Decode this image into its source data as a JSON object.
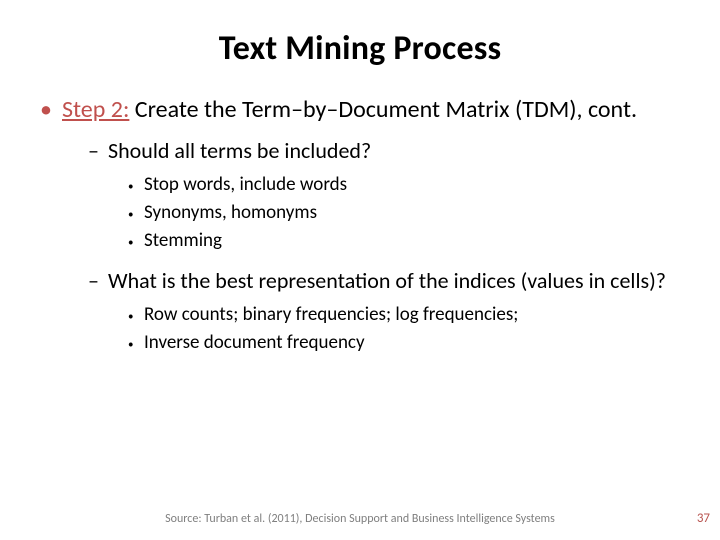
{
  "title": "Text Mining Process",
  "step": {
    "label": "Step 2:",
    "rest": " Create the Term–by–Document Matrix (TDM), cont."
  },
  "q1": {
    "text": "Should all terms be included?",
    "sub": [
      "Stop words, include words",
      "Synonyms, homonyms",
      "Stemming"
    ]
  },
  "q2": {
    "text": "What is the best representation of the indices (values in cells)?",
    "sub": [
      "Row counts; binary frequencies; log frequencies;",
      "Inverse document frequency"
    ]
  },
  "source": "Source: Turban et al. (2011), Decision Support and Business Intelligence Systems",
  "page": "37"
}
